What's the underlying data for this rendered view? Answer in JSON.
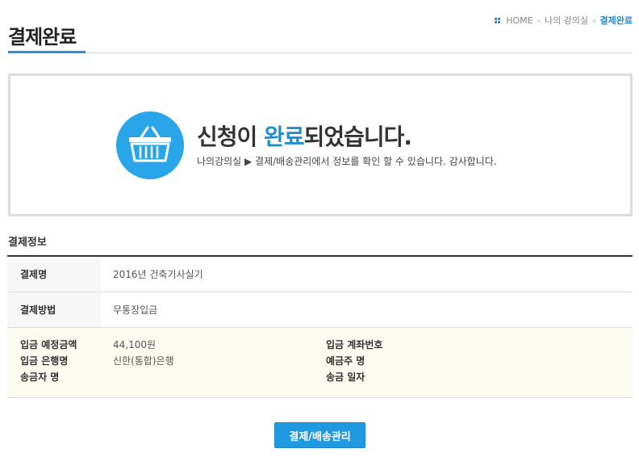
{
  "header": {
    "title": "결제완료",
    "breadcrumb": {
      "home": "HOME",
      "parent": "나의 강의실",
      "current": "결제완료"
    }
  },
  "completion": {
    "msg_before": "신청이 ",
    "msg_highlight": "완료",
    "msg_after": "되었습니다.",
    "sub": "나의강의실 ▶ 결제/배송관리에서 정보를 확인 할 수 있습니다. 감사합니다."
  },
  "payment_info": {
    "section_title": "결제정보",
    "rows": [
      {
        "label": "결제명",
        "value": "2016년 건축기사실기"
      },
      {
        "label": "결제방법",
        "value": "무통장입금"
      }
    ],
    "deposit": {
      "amount_label": "입금 예정금액",
      "amount_value": "44,100원",
      "account_label": "입금 계좌번호",
      "account_value": "",
      "bank_label": "입금 은행명",
      "bank_value": "신한(통합)은행",
      "holder_label": "예금주 명",
      "holder_value": "",
      "sender_label": "송금자 명",
      "sender_value": "",
      "date_label": "송금 일자",
      "date_value": ""
    }
  },
  "actions": {
    "manage_button": "결제/배송관리"
  },
  "colors": {
    "accent": "#1f8fd4",
    "button": "#1f9ae0",
    "icon_bg": "#29a6ea",
    "deposit_bg": "#fcfbf0"
  },
  "icons": {
    "home": "grid-icon",
    "complete": "basket-icon"
  }
}
